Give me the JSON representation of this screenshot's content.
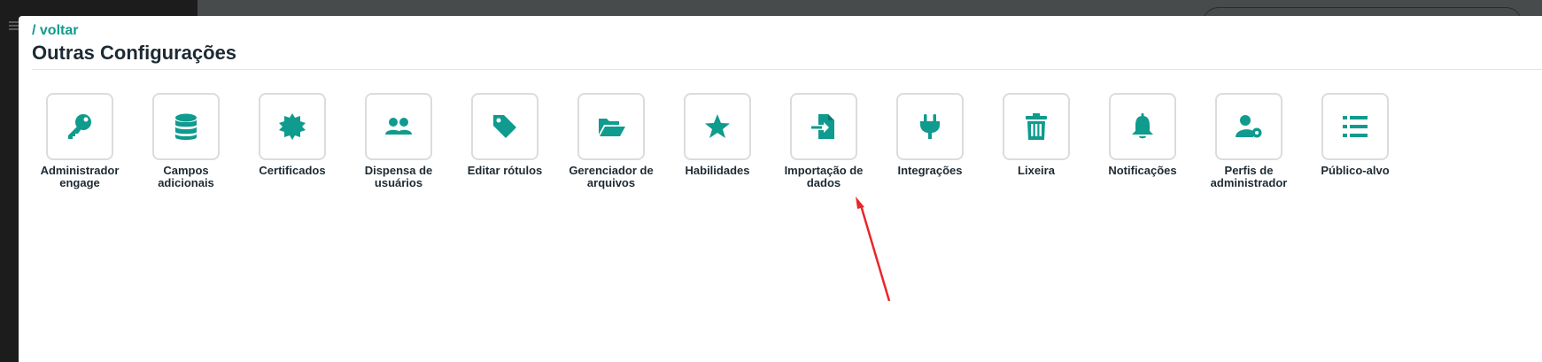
{
  "colors": {
    "accent": "#0f9b8e",
    "title": "#1d2a33",
    "annotation_arrow": "#e8262a"
  },
  "nav": {
    "back_label": "/ voltar"
  },
  "header": {
    "title": "Outras Configurações"
  },
  "tiles": [
    {
      "label": "Administrador engage",
      "icon": "key-icon"
    },
    {
      "label": "Campos adicionais",
      "icon": "database-icon"
    },
    {
      "label": "Certificados",
      "icon": "certificate-icon"
    },
    {
      "label": "Dispensa de usuários",
      "icon": "users-icon"
    },
    {
      "label": "Editar rótulos",
      "icon": "tag-icon"
    },
    {
      "label": "Gerenciador de arquivos",
      "icon": "folder-open-icon"
    },
    {
      "label": "Habilidades",
      "icon": "star-icon"
    },
    {
      "label": "Importação de dados",
      "icon": "file-import-icon"
    },
    {
      "label": "Integrações",
      "icon": "plug-icon"
    },
    {
      "label": "Lixeira",
      "icon": "trash-icon"
    },
    {
      "label": "Notificações",
      "icon": "bell-icon"
    },
    {
      "label": "Perfis de administrador",
      "icon": "user-cog-icon"
    },
    {
      "label": "Público-alvo",
      "icon": "list-icon"
    }
  ]
}
